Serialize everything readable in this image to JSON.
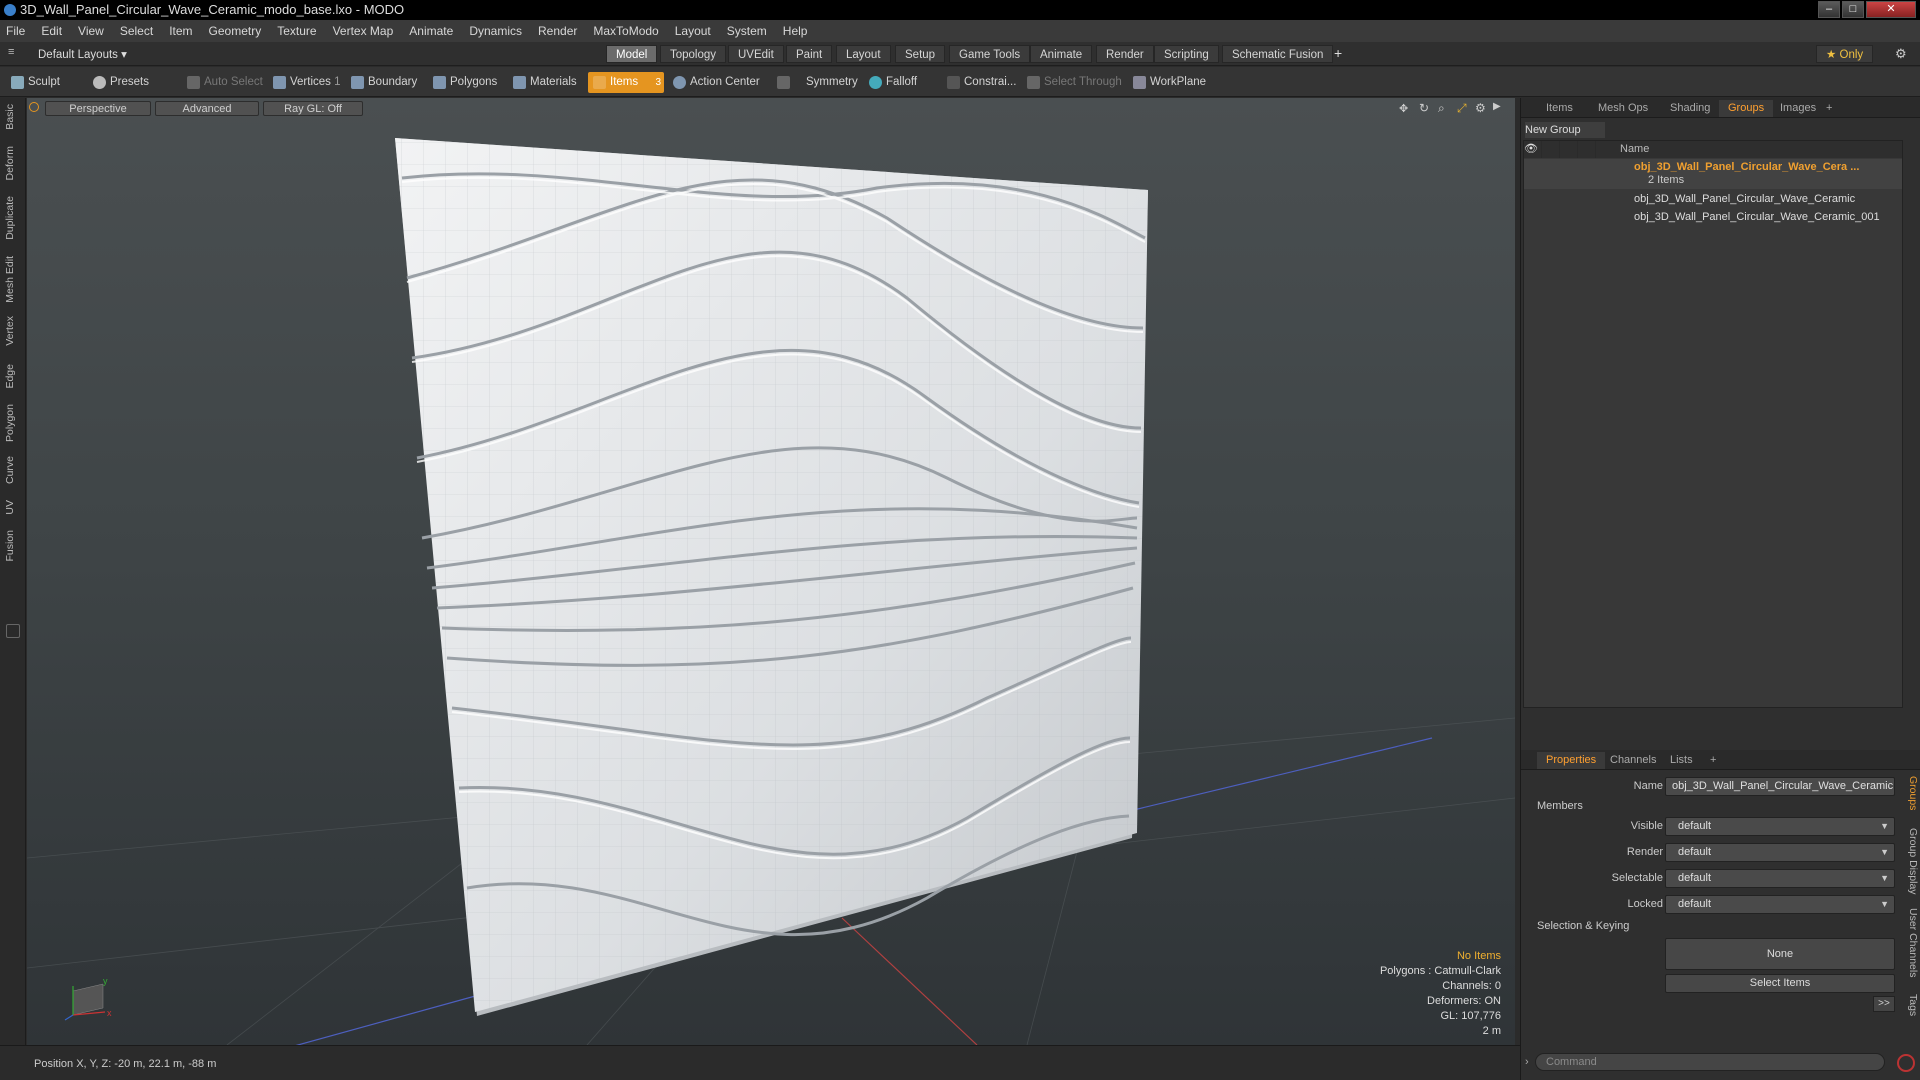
{
  "window": {
    "title": "3D_Wall_Panel_Circular_Wave_Ceramic_modo_base.lxo - MODO",
    "min": "–",
    "max": "□",
    "close": "✕"
  },
  "menu": [
    "File",
    "Edit",
    "View",
    "Select",
    "Item",
    "Geometry",
    "Texture",
    "Vertex Map",
    "Animate",
    "Dynamics",
    "Render",
    "MaxToModo",
    "Layout",
    "System",
    "Help"
  ],
  "layouts": {
    "selector": "Default Layouts ▾",
    "tabs": [
      "Model",
      "Topology",
      "UVEdit",
      "Paint",
      "Layout",
      "Setup",
      "Game Tools",
      "Animate",
      "Render",
      "Scripting",
      "Schematic Fusion"
    ],
    "active": "Model",
    "add": "+",
    "only": "★ Only",
    "gear": "⚙"
  },
  "toolbar": {
    "sculpt": "Sculpt",
    "presets": "Presets",
    "auto_select": "Auto Select",
    "vertices": "Vertices",
    "vertices_count": "1",
    "boundary": "Boundary",
    "polygons": "Polygons",
    "materials": "Materials",
    "items": "Items",
    "items_count": "3",
    "action_center": "Action Center",
    "symmetry": "Symmetry",
    "falloff": "Falloff",
    "constraints": "Constrai...",
    "select_through": "Select Through",
    "workplane": "WorkPlane"
  },
  "left_tabs": [
    "Basic",
    "Deform",
    "Duplicate",
    "Mesh Edit",
    "Vertex",
    "Edge",
    "Polygon",
    "Curve",
    "UV",
    "Fusion"
  ],
  "viewport": {
    "perspective": "Perspective",
    "advanced": "Advanced",
    "raygl": "Ray GL: Off",
    "info": {
      "items": "No Items",
      "polygons": "Polygons : Catmull-Clark",
      "channels": "Channels: 0",
      "deformers": "Deformers: ON",
      "gl": "GL: 107,776",
      "scale": "2 m"
    },
    "axis": {
      "x": "x",
      "y": "y"
    }
  },
  "status": {
    "position": "Position X, Y, Z:  -20 m, 22.1 m, -88 m"
  },
  "groups_panel": {
    "tabs": [
      "Items",
      "Mesh Ops",
      "Shading",
      "Groups",
      "Images"
    ],
    "active": "Groups",
    "add": "+",
    "new_group": "New Group",
    "col_name": "Name",
    "group_name": "obj_3D_Wall_Panel_Circular_Wave_Cera ...",
    "group_count": "2 Items",
    "children": [
      "obj_3D_Wall_Panel_Circular_Wave_Ceramic",
      "obj_3D_Wall_Panel_Circular_Wave_Ceramic_001"
    ]
  },
  "props_panel": {
    "tabs": [
      "Properties",
      "Channels",
      "Lists"
    ],
    "active": "Properties",
    "add": "+",
    "name_label": "Name",
    "name_value": "obj_3D_Wall_Panel_Circular_Wave_Ceramic (",
    "members": "Members",
    "visible_label": "Visible",
    "visible": "default",
    "render_label": "Render",
    "render": "default",
    "selectable_label": "Selectable",
    "selectable": "default",
    "locked_label": "Locked",
    "locked": "default",
    "sel_keying": "Selection & Keying",
    "none": "None",
    "select_items": "Select Items",
    "more": ">>",
    "side_tabs": [
      "Groups",
      "Group Display",
      "User Channels",
      "Tags"
    ],
    "command_placeholder": "Command"
  }
}
